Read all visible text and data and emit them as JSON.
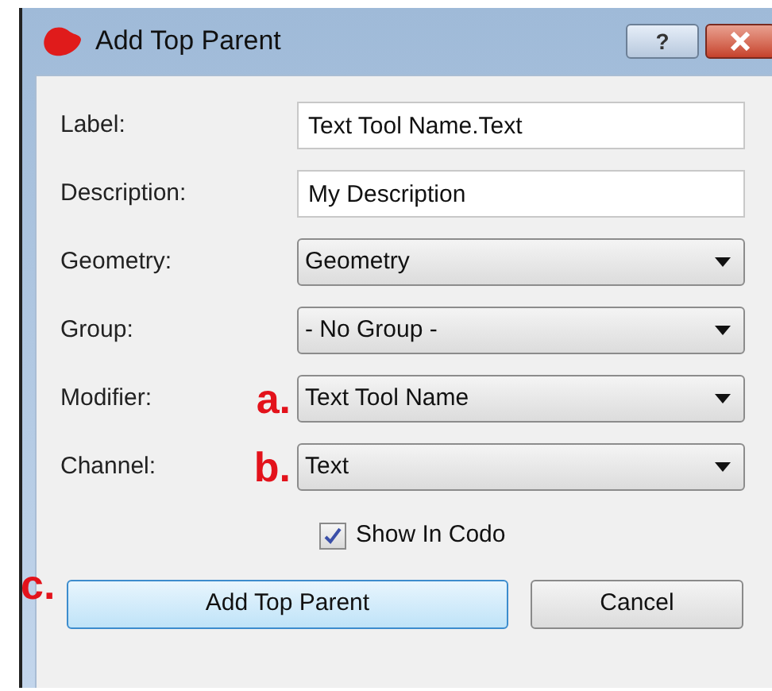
{
  "window": {
    "title": "Add Top Parent",
    "help_button": "?"
  },
  "fields": [
    {
      "kind": "text",
      "label": "Label:",
      "value": "Text Tool Name.Text"
    },
    {
      "kind": "text",
      "label": "Description:",
      "value": "My Description"
    },
    {
      "kind": "dropdown",
      "label": "Geometry:",
      "value": "Geometry"
    },
    {
      "kind": "dropdown",
      "label": "Group:",
      "value": "- No Group -"
    },
    {
      "kind": "dropdown",
      "label": "Modifier:",
      "value": "Text Tool Name",
      "annotation": "a."
    },
    {
      "kind": "dropdown",
      "label": "Channel:",
      "value": "Text",
      "annotation": "b."
    }
  ],
  "checkbox": {
    "label": "Show In Codo",
    "checked": true
  },
  "buttons_annotation": "c.",
  "buttons": [
    {
      "label": "Add Top Parent",
      "selected": true
    },
    {
      "label": "Cancel",
      "selected": false
    }
  ]
}
